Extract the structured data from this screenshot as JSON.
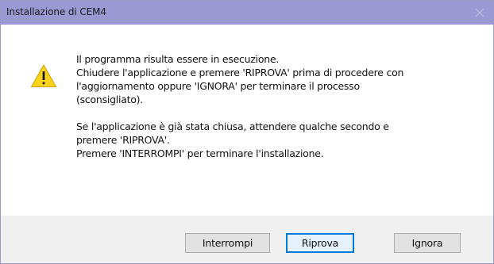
{
  "window": {
    "title": "Installazione di CEM4"
  },
  "message": {
    "paragraph1": [
      "Il programma risulta essere in esecuzione.",
      "Chiudere l'applicazione e premere 'RIPROVA' prima di procedere con",
      "l'aggiornamento oppure 'IGNORA' per terminare il processo",
      "(sconsigliato)."
    ],
    "paragraph2": [
      "Se l'applicazione è già stata chiusa, attendere qualche secondo e",
      "premere 'RIPROVA'.",
      "Premere 'INTERROMPI' per terminare l'installazione."
    ]
  },
  "buttons": {
    "abort": "Interrompi",
    "retry": "Riprova",
    "ignore": "Ignora"
  },
  "icons": {
    "warning": "warning-icon",
    "close": "close-icon"
  },
  "colors": {
    "titlebar": "#9b99d4",
    "warning_fill": "#ffd21c",
    "default_button_border": "#0078d7"
  }
}
